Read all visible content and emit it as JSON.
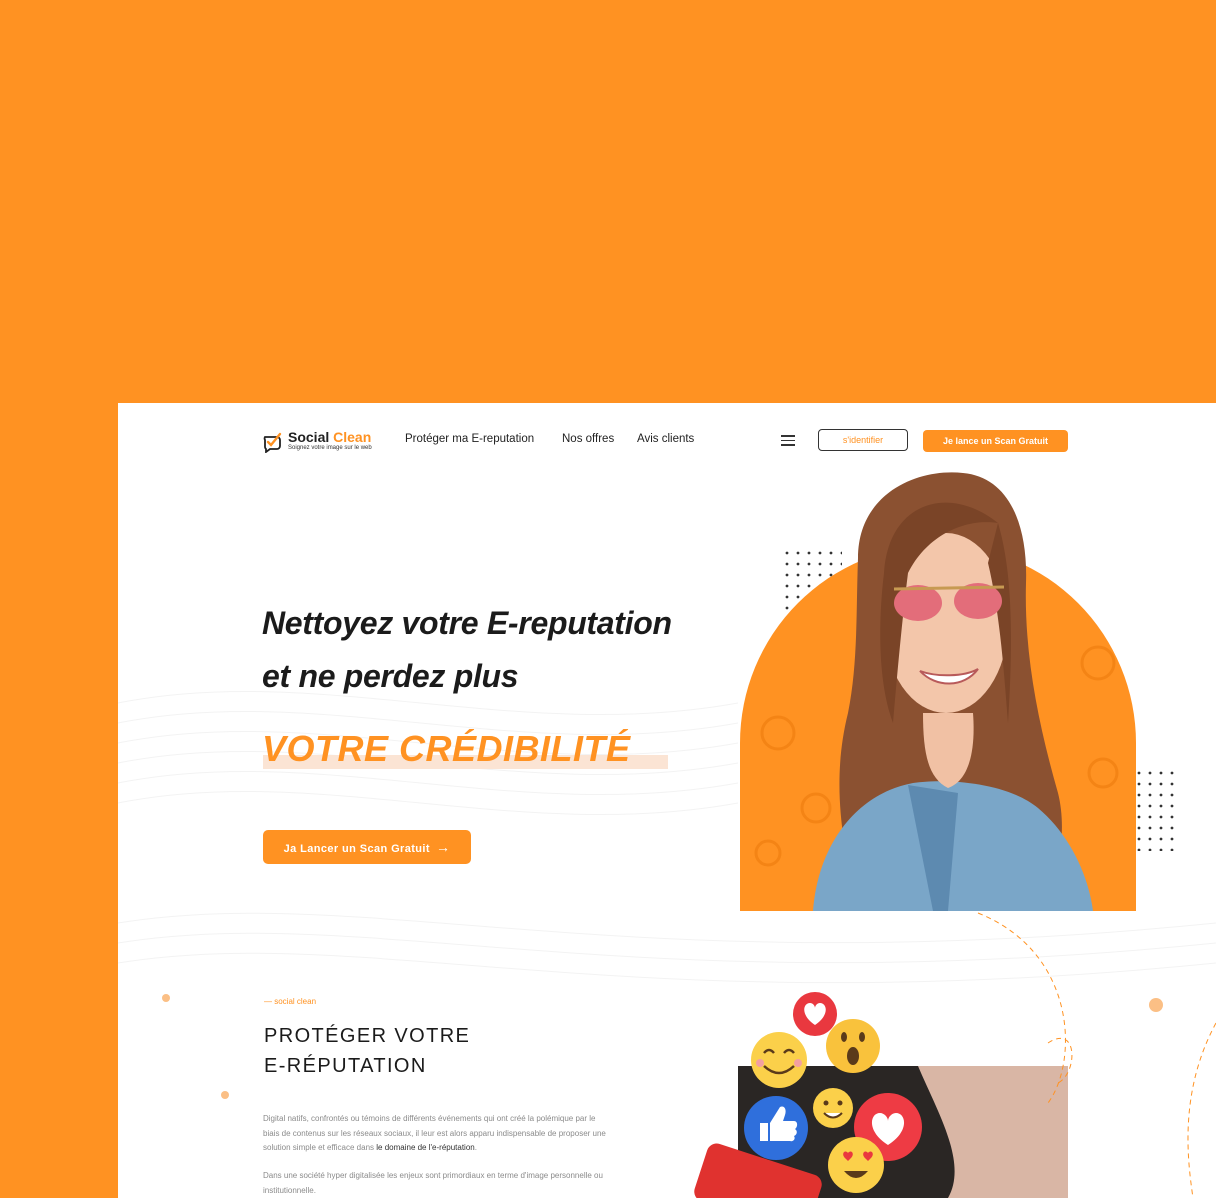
{
  "logo": {
    "name_part1": "Social",
    "name_part2": "Clean",
    "tagline": "Soignez votre image sur le web"
  },
  "nav": {
    "items": [
      {
        "label": "Protéger ma E-reputation"
      },
      {
        "label": "Nos offres"
      },
      {
        "label": "Avis clients"
      }
    ]
  },
  "header": {
    "login_label": "s'identifier",
    "scan_label": "Je lance un Scan Gratuit"
  },
  "hero": {
    "line1": "Nettoyez votre E-reputation",
    "line2": "et ne perdez plus",
    "line3": "VOTRE CRÉDIBILITÉ",
    "cta_label": "Ja Lancer un Scan Gratuit"
  },
  "section": {
    "kicker": "— social clean",
    "title_line1": "PROTÉGER VOTRE",
    "title_line2": "E-RÉPUTATION",
    "p1_text": "Digital natifs, confrontés ou témoins de différents événements qui ont créé la polémique par le biais de contenus sur les réseaux sociaux, il leur est alors apparu indispensable de proposer une solution simple et efficace dans ",
    "p1_link": "le domaine de l'e-réputation",
    "p1_end": ".",
    "p2_text": "Dans une société hyper digitalisée les enjeux sont primordiaux en terme d'image personnelle ou institutionnelle."
  },
  "colors": {
    "brand_orange": "#ff9222",
    "text_dark": "#1b1b1b",
    "highlight": "#fbe4d4"
  },
  "icons": [
    "checkmark-speech-logo-icon",
    "menu-icon",
    "arrow-right-icon",
    "heart-reaction-icon",
    "wow-reaction-icon",
    "smile-reaction-icon",
    "like-reaction-icon",
    "love-eyes-reaction-icon"
  ]
}
